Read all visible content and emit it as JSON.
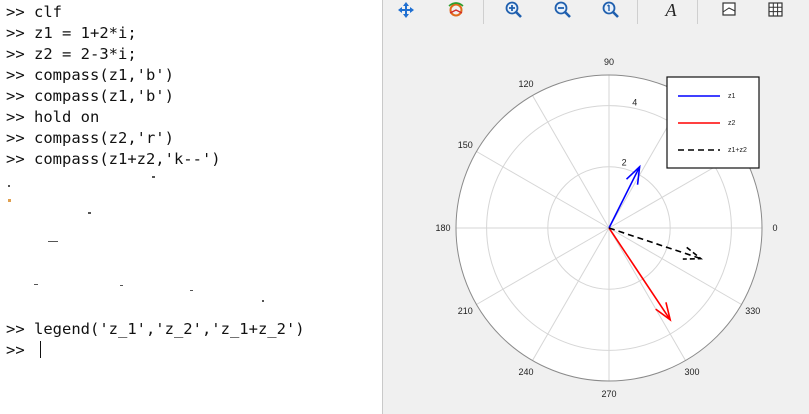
{
  "console": {
    "lines": [
      ">> clf",
      ">> z1 = 1+2*i;",
      ">> z2 = 2-3*i;",
      ">> compass(z1,'b')",
      ">> compass(z1,'b')",
      ">> hold on",
      ">> compass(z2,'r')",
      ">> compass(z1+z2,'k--')",
      ">> legend('z_1','z_2','z_1+z_2')",
      ">> "
    ]
  },
  "toolbar": {
    "icons": [
      "pan-icon",
      "rotate-icon",
      "zoom-in-icon",
      "zoom-out-icon",
      "zoom-reset-icon",
      "text-icon",
      "axes-icon",
      "grid-icon"
    ],
    "text_glyph": "A"
  },
  "chart_data": {
    "type": "compass",
    "rlim": [
      0,
      5
    ],
    "ring_labels": [
      "2",
      "4"
    ],
    "angle_labels": [
      "90",
      "120",
      "150",
      "180",
      "210",
      "240",
      "270",
      "300",
      "330",
      "0"
    ],
    "series": [
      {
        "name": "z1",
        "x": [
          1
        ],
        "y": [
          2
        ],
        "color": "#0000ff",
        "style": "solid"
      },
      {
        "name": "z2",
        "x": [
          2
        ],
        "y": [
          -3
        ],
        "color": "#ff0000",
        "style": "solid"
      },
      {
        "name": "z1+z2",
        "x": [
          3
        ],
        "y": [
          -1
        ],
        "color": "#000000",
        "style": "dashed"
      }
    ],
    "legend": {
      "position": "top-right",
      "entries": [
        "z1",
        "z2",
        "z1+z2"
      ]
    }
  }
}
